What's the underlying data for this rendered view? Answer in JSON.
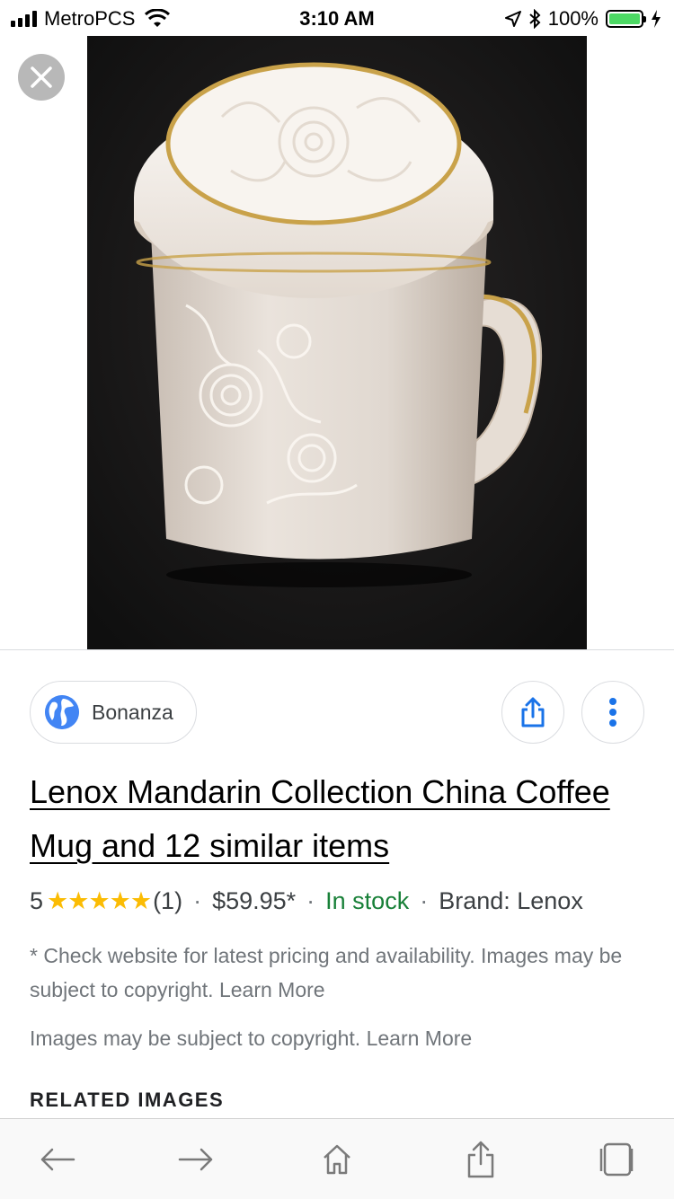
{
  "status_bar": {
    "carrier": "MetroPCS",
    "time": "3:10 AM",
    "battery": "100%",
    "battery_level": 1.0,
    "icons": [
      "signal-bars-icon",
      "wifi-icon",
      "location-arrow-icon",
      "bluetooth-icon",
      "battery-icon",
      "charging-bolt-icon"
    ]
  },
  "viewer": {
    "close_icon": "close-icon",
    "image_subject": "lidded white embossed porcelain mug with gold rim on black background"
  },
  "source": {
    "name": "Bonanza",
    "icon": "globe-icon"
  },
  "actions": {
    "share_icon": "share-icon",
    "more_icon": "more-vert-icon"
  },
  "product": {
    "title": "Lenox Mandarin Collection China Coffee Mug and 12 similar items",
    "rating": "5",
    "stars": "★★★★★",
    "rating_value": 5,
    "rating_max": 5,
    "review_count": "(1)",
    "separator": "·",
    "price": "$59.95*",
    "availability": "In stock",
    "brand": "Brand: Lenox",
    "disclaimer": "* Check website for latest pricing and availability. Images may be subject to copyright. Learn More",
    "copyright_note": "Images may be subject to copyright. Learn More"
  },
  "related_heading": "RELATED IMAGES",
  "toolbar": {
    "items": [
      "back-arrow-icon",
      "forward-arrow-icon",
      "home-icon",
      "share-icon",
      "tabs-icon"
    ]
  },
  "colors": {
    "star": "#fbbc04",
    "in_stock": "#188038",
    "link_blue": "#4285f4",
    "battery_green": "#4cd964"
  }
}
